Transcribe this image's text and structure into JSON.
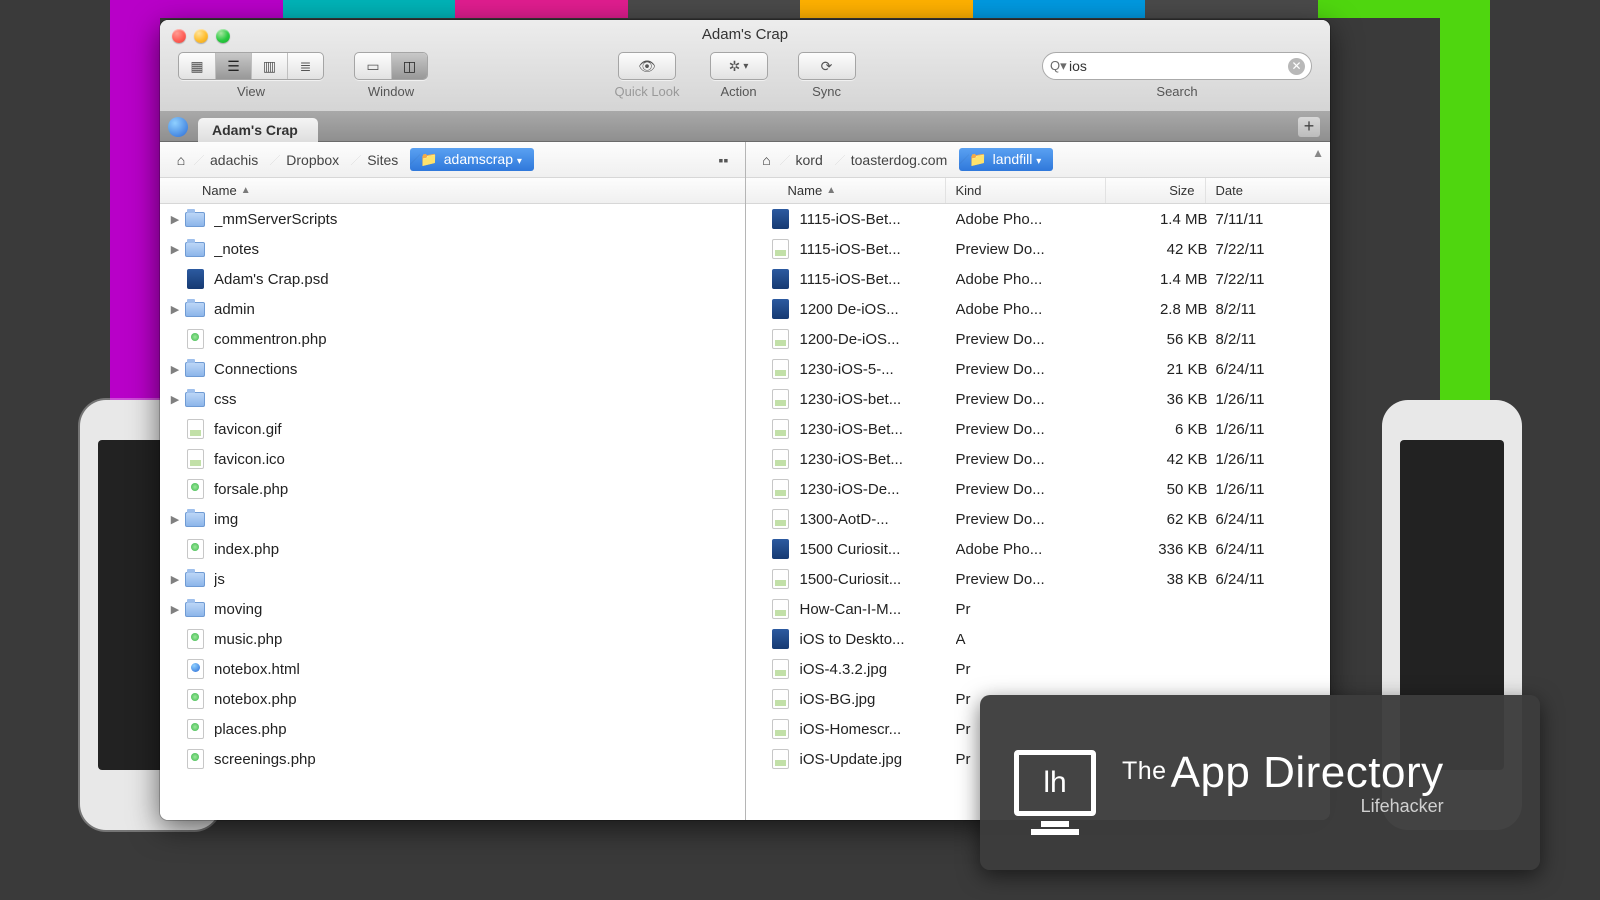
{
  "window_title": "Adam's Crap",
  "toolbar": {
    "view_label": "View",
    "window_label": "Window",
    "quicklook_label": "Quick Look",
    "action_label": "Action",
    "sync_label": "Sync",
    "search_label": "Search"
  },
  "search": {
    "value": "ios"
  },
  "tab": {
    "title": "Adam's Crap"
  },
  "left_pane": {
    "path": [
      "adachis",
      "Dropbox",
      "Sites",
      "adamscrap"
    ],
    "selected_crumb_index": 3,
    "columns": {
      "name": "Name"
    },
    "items": [
      {
        "icon": "folder",
        "name": "_mmServerScripts",
        "expandable": true
      },
      {
        "icon": "folder",
        "name": "_notes",
        "expandable": true
      },
      {
        "icon": "psd",
        "name": "Adam's Crap.psd",
        "expandable": false
      },
      {
        "icon": "folder",
        "name": "admin",
        "expandable": true
      },
      {
        "icon": "php",
        "name": "commentron.php",
        "expandable": false
      },
      {
        "icon": "folder",
        "name": "Connections",
        "expandable": true
      },
      {
        "icon": "folder",
        "name": "css",
        "expandable": true
      },
      {
        "icon": "img",
        "name": "favicon.gif",
        "expandable": false
      },
      {
        "icon": "img",
        "name": "favicon.ico",
        "expandable": false
      },
      {
        "icon": "php",
        "name": "forsale.php",
        "expandable": false
      },
      {
        "icon": "folder",
        "name": "img",
        "expandable": true
      },
      {
        "icon": "php",
        "name": "index.php",
        "expandable": false
      },
      {
        "icon": "folder",
        "name": "js",
        "expandable": true
      },
      {
        "icon": "folder",
        "name": "moving",
        "expandable": true
      },
      {
        "icon": "php",
        "name": "music.php",
        "expandable": false
      },
      {
        "icon": "html",
        "name": "notebox.html",
        "expandable": false
      },
      {
        "icon": "php",
        "name": "notebox.php",
        "expandable": false
      },
      {
        "icon": "php",
        "name": "places.php",
        "expandable": false
      },
      {
        "icon": "php",
        "name": "screenings.php",
        "expandable": false
      }
    ]
  },
  "right_pane": {
    "path": [
      "kord",
      "toasterdog.com",
      "landfill"
    ],
    "selected_crumb_index": 2,
    "columns": {
      "name": "Name",
      "kind": "Kind",
      "size": "Size",
      "date": "Date"
    },
    "items": [
      {
        "icon": "psd",
        "name": "1115-iOS-Bet...",
        "kind": "Adobe Pho...",
        "size": "1.4 MB",
        "date": "7/11/11"
      },
      {
        "icon": "img",
        "name": "1115-iOS-Bet...",
        "kind": "Preview Do...",
        "size": "42 KB",
        "date": "7/22/11"
      },
      {
        "icon": "psd",
        "name": "1115-iOS-Bet...",
        "kind": "Adobe Pho...",
        "size": "1.4 MB",
        "date": "7/22/11"
      },
      {
        "icon": "psd",
        "name": "1200 De-iOS...",
        "kind": "Adobe Pho...",
        "size": "2.8 MB",
        "date": "8/2/11"
      },
      {
        "icon": "img",
        "name": "1200-De-iOS...",
        "kind": "Preview Do...",
        "size": "56 KB",
        "date": "8/2/11"
      },
      {
        "icon": "img",
        "name": "1230-iOS-5-...",
        "kind": "Preview Do...",
        "size": "21 KB",
        "date": "6/24/11"
      },
      {
        "icon": "img",
        "name": "1230-iOS-bet...",
        "kind": "Preview Do...",
        "size": "36 KB",
        "date": "1/26/11"
      },
      {
        "icon": "img",
        "name": "1230-iOS-Bet...",
        "kind": "Preview Do...",
        "size": "6 KB",
        "date": "1/26/11"
      },
      {
        "icon": "img",
        "name": "1230-iOS-Bet...",
        "kind": "Preview Do...",
        "size": "42 KB",
        "date": "1/26/11"
      },
      {
        "icon": "img",
        "name": "1230-iOS-De...",
        "kind": "Preview Do...",
        "size": "50 KB",
        "date": "1/26/11"
      },
      {
        "icon": "img",
        "name": "1300-AotD-...",
        "kind": "Preview Do...",
        "size": "62 KB",
        "date": "6/24/11"
      },
      {
        "icon": "psd",
        "name": "1500 Curiosit...",
        "kind": "Adobe Pho...",
        "size": "336 KB",
        "date": "6/24/11"
      },
      {
        "icon": "img",
        "name": "1500-Curiosit...",
        "kind": "Preview Do...",
        "size": "38 KB",
        "date": "6/24/11"
      },
      {
        "icon": "img",
        "name": "How-Can-I-M...",
        "kind": "Pr",
        "size": "",
        "date": ""
      },
      {
        "icon": "psd",
        "name": "iOS to Deskto...",
        "kind": "A",
        "size": "",
        "date": ""
      },
      {
        "icon": "img",
        "name": "iOS-4.3.2.jpg",
        "kind": "Pr",
        "size": "",
        "date": ""
      },
      {
        "icon": "img",
        "name": "iOS-BG.jpg",
        "kind": "Pr",
        "size": "",
        "date": ""
      },
      {
        "icon": "img",
        "name": "iOS-Homescr...",
        "kind": "Pr",
        "size": "",
        "date": ""
      },
      {
        "icon": "img",
        "name": "iOS-Update.jpg",
        "kind": "Pr",
        "size": "",
        "date": ""
      }
    ]
  },
  "overlay": {
    "prefix": "The",
    "main": "App Directory",
    "sub": "Lifehacker",
    "icon_text": "lh"
  },
  "colors": {
    "stripes": [
      "#b800c8",
      "#00b3b7",
      "#e01d8f",
      "#4a4a4a",
      "#ffb100",
      "#0099e0",
      "#4a4a4a",
      "#4fd60f"
    ]
  }
}
